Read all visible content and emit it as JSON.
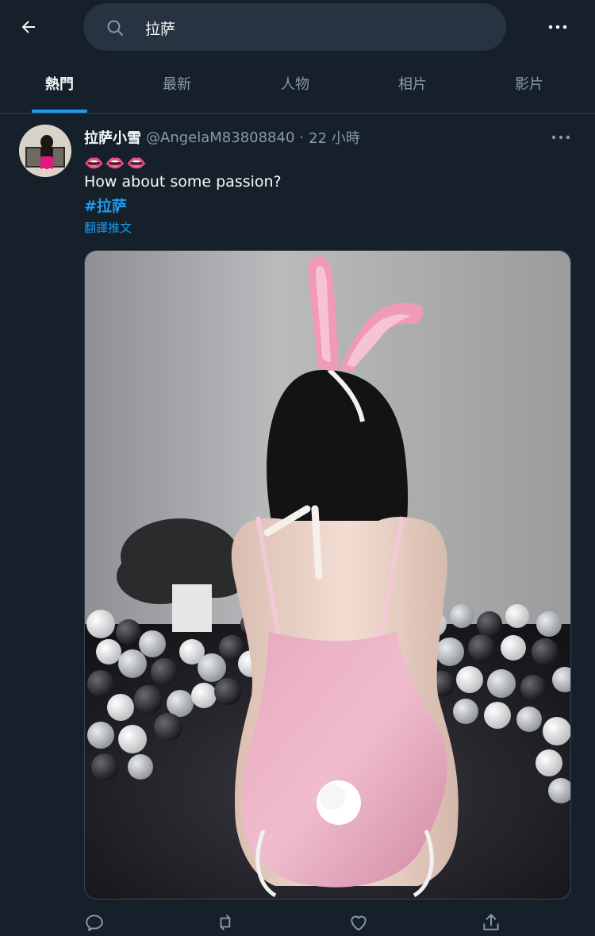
{
  "search": {
    "query": "拉萨"
  },
  "tabs": [
    {
      "label": "熱門",
      "active": true
    },
    {
      "label": "最新",
      "active": false
    },
    {
      "label": "人物",
      "active": false
    },
    {
      "label": "相片",
      "active": false
    },
    {
      "label": "影片",
      "active": false
    }
  ],
  "tweet": {
    "display_name": "拉萨小雪",
    "handle": "@AngelaM83808840",
    "separator": "·",
    "time": "22 小時",
    "emoji": "👄👄👄",
    "text": "How about some passion?",
    "hashtag": "#拉萨",
    "translate_label": "翻譯推文"
  },
  "icons": {
    "back": "arrow-left-icon",
    "search": "search-icon",
    "more": "more-horizontal-icon",
    "reply": "reply-icon",
    "retweet": "retweet-icon",
    "like": "heart-icon",
    "share": "share-icon"
  },
  "colors": {
    "background": "#15202b",
    "accent": "#1d9bf0",
    "secondary_text": "#8b98a5",
    "search_bg": "#273340"
  }
}
